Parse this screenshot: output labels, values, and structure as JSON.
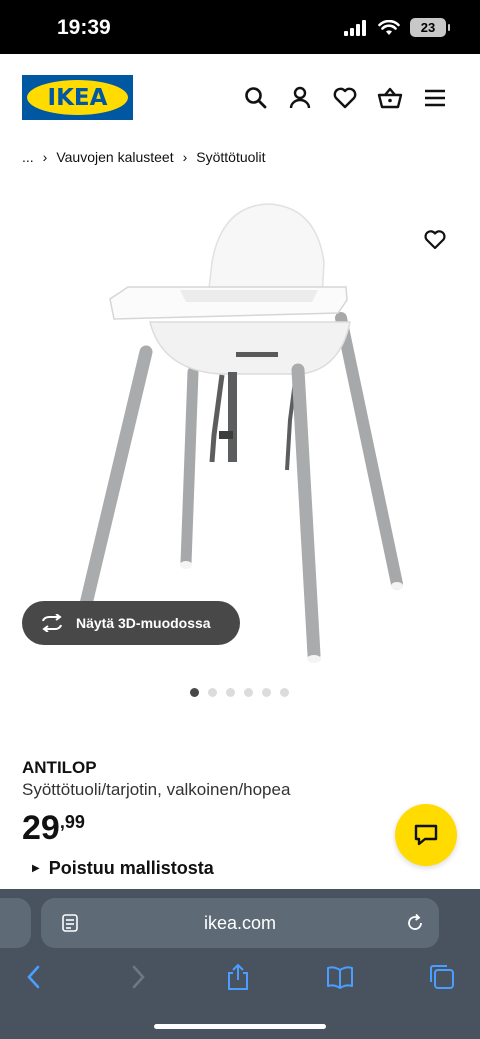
{
  "status_bar": {
    "time": "19:39",
    "battery": "23"
  },
  "header": {
    "logo_text": "IKEA",
    "icons": [
      "search-icon",
      "user-icon",
      "heart-icon",
      "basket-icon",
      "menu-icon"
    ]
  },
  "breadcrumb": {
    "items": [
      "...",
      "Vauvojen kalusteet",
      "Syöttötuolit"
    ]
  },
  "gallery": {
    "view_3d_label": "Näytä 3D-muodossa",
    "dot_count": 6,
    "active_dot": 0
  },
  "product": {
    "name": "ANTILOP",
    "description": "Syöttötuoli/tarjotin, valkoinen/hopea",
    "price_int": "29",
    "price_dec": ",99",
    "status": "Poistuu mallistosta"
  },
  "browser": {
    "url": "ikea.com"
  },
  "colors": {
    "ikea_blue": "#0058a3",
    "ikea_yellow": "#ffdb00",
    "toolbar": "#48535f",
    "toolbar_link": "#4a9eff"
  }
}
